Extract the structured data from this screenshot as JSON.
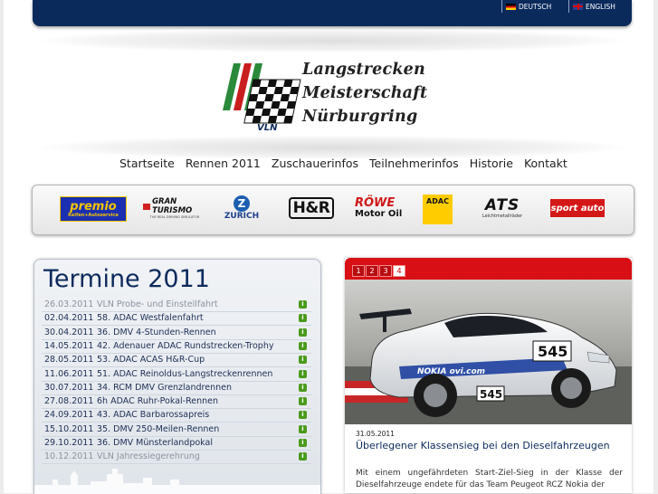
{
  "lang": {
    "de": "DEUTSCH",
    "en": "ENGLISH"
  },
  "logo": {
    "line1": "Langstrecken",
    "line2": "Meisterschaft",
    "line3": "Nürburgring",
    "badge": "VLN"
  },
  "nav": [
    "Startseite",
    "Rennen 2011",
    "Zuschauerinfos",
    "Teilnehmerinfos",
    "Historie",
    "Kontakt"
  ],
  "sponsors": [
    {
      "name": "premio",
      "sub": "Reifen+Autoservice"
    },
    {
      "name": "GRAN TURISMO",
      "sub": "THE REAL DRIVING SIMULATOR"
    },
    {
      "name": "ZURICH"
    },
    {
      "name": "H&R"
    },
    {
      "name": "RÖWE",
      "sub": "Motor Oil"
    },
    {
      "name": "ADAC"
    },
    {
      "name": "ATS",
      "sub": "Leichtmetallräder"
    },
    {
      "name": "sport auto"
    }
  ],
  "termine": {
    "title": "Termine 2011",
    "rows": [
      {
        "date": "26.03.2011",
        "title": "VLN Probe- und Einstellfahrt"
      },
      {
        "date": "02.04.2011",
        "title": "58. ADAC Westfalenfahrt"
      },
      {
        "date": "30.04.2011",
        "title": "36. DMV 4-Stunden-Rennen"
      },
      {
        "date": "14.05.2011",
        "title": "42. Adenauer ADAC Rundstrecken-Trophy"
      },
      {
        "date": "28.05.2011",
        "title": "53. ADAC ACAS H&R-Cup"
      },
      {
        "date": "11.06.2011",
        "title": "51. ADAC Reinoldus-Langstreckenrennen"
      },
      {
        "date": "30.07.2011",
        "title": "34. RCM DMV Grenzlandrennen"
      },
      {
        "date": "27.08.2011",
        "title": "6h ADAC Ruhr-Pokal-Rennen"
      },
      {
        "date": "24.09.2011",
        "title": "43. ADAC Barbarossapreis"
      },
      {
        "date": "15.10.2011",
        "title": "35. DMV 250-Meilen-Rennen"
      },
      {
        "date": "29.10.2011",
        "title": "36. DMV Münsterlandpokal"
      },
      {
        "date": "10.12.2011",
        "title": "VLN Jahressiegerehrung"
      }
    ],
    "info_icon": "i"
  },
  "news": {
    "pages": [
      "1",
      "2",
      "3",
      "4"
    ],
    "active_page": "4",
    "date": "31.05.2011",
    "title": "Überlegener Klassensieg bei den Dieselfahrzeugen",
    "text": "Mit einem ungefährdeten Start-Ziel-Sieg in der Klasse der Dieselfahrzeuge endete für das Team Peugeot RCZ Nokia der",
    "car_number": "545",
    "car_sponsor": "NOKIA ovi.com"
  }
}
